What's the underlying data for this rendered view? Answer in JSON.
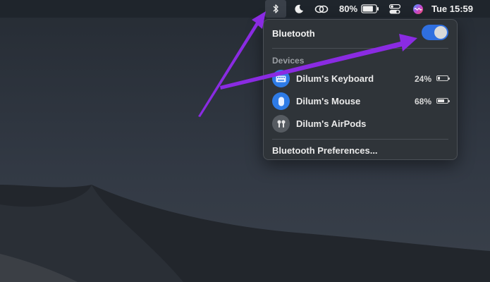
{
  "menubar": {
    "battery_percent": "80%",
    "battery_level": 0.8,
    "clock": "Tue 15:59",
    "icons": [
      "bluetooth-icon",
      "moon-icon",
      "link-icon",
      "battery-icon",
      "control-center-icon",
      "siri-icon"
    ]
  },
  "bluetooth_panel": {
    "title": "Bluetooth",
    "toggle_on": true,
    "section_label": "Devices",
    "devices": [
      {
        "name": "Dilum's Keyboard",
        "battery": "24%",
        "battery_level": 0.24,
        "connected": true,
        "icon": "keyboard-icon"
      },
      {
        "name": "Dilum's Mouse",
        "battery": "68%",
        "battery_level": 0.68,
        "connected": true,
        "icon": "mouse-icon"
      },
      {
        "name": "Dilum's AirPods",
        "battery": "",
        "connected": false,
        "icon": "airpods-icon"
      }
    ],
    "preferences_label": "Bluetooth Preferences..."
  },
  "colors": {
    "accent": "#2f6fe0",
    "annotation_arrow": "#8a2be2",
    "panel_bg": "#2f3439",
    "menubar_bg": "#1f252c"
  }
}
